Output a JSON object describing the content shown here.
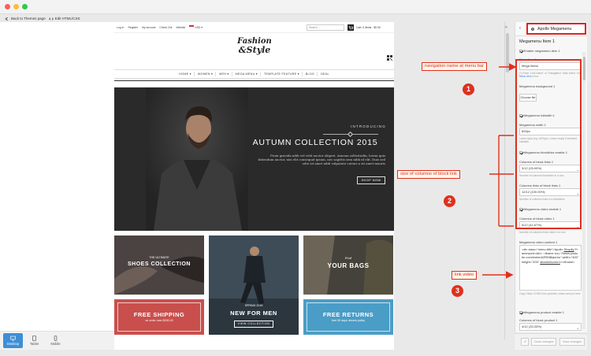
{
  "editor_toolbar": {
    "back_label": "Back to Themes page",
    "edit_label": "Edit HTML/CSS"
  },
  "devices": [
    {
      "label": "Desktop"
    },
    {
      "label": "Tablet"
    },
    {
      "label": "Mobile"
    }
  ],
  "site": {
    "topbar": {
      "links": [
        "Log In",
        "Register",
        "My account",
        "Check Out",
        "Wishlist"
      ],
      "currency": "USD",
      "search_placeholder": "Search ...",
      "cart_text": "Cart: 0 items - $0.00"
    },
    "logo": {
      "line1": "Fashion",
      "line2": "&Style"
    },
    "menu": [
      "HOME ▾",
      "WOMEN ▾",
      "MEN ▾",
      "MEGA MENU ▾",
      "TEMPLATE FEATURE ▾",
      "BLOG",
      "DEAL"
    ],
    "hero": {
      "intro": "INTRODUCING",
      "title": "AUTUMN COLLECTION 2015",
      "desc": "Proin gravida nibh vel velit auctor aliquet. Aenean sollicitudin, lorem quis bibendum auctor, nisi elit consequat ipsum, nec sagittis sem nibh id elit. Duis sed odio sit amet nibh vulputate cursus a sit amet mauris",
      "button": "SHOP NOW"
    },
    "tiles": {
      "shoes_small": "THE ULTIMATE",
      "shoes_big": "SHOES COLLECTION",
      "men_small": "SPRING 2015",
      "men_big": "NEW FOR MEN",
      "men_button": "VIEW COLLECTION",
      "bags_small": "Find",
      "bags_big": "YOUR BAGS",
      "shipping_big": "FREE SHIPPING",
      "shipping_small": "on order over $150.00",
      "returns_big": "FREE RETURNS",
      "returns_small": "free 90 days returns policy"
    }
  },
  "panel": {
    "title": "Apollo Megamenu",
    "section": "Megamenu Item 1",
    "enable_label": "Enable megamenu item 1",
    "menu_item_label": "Menu item 1",
    "menu_item_value": "Mega Menu",
    "menu_item_help_pre": "(*) Enter \"Link Name\" or \"Navigation\" Main Menu\" into",
    "menu_item_help_link": "Menu Item 1",
    "menu_item_help_post": "box",
    "background_label": "Megamenu background 1",
    "choose_file": "Choose file",
    "fullwidth_label": "Megamenu fullwidth 1",
    "width_label": "Megamenu width 1",
    "width_value": "600px",
    "width_help": "Leave input (eg: 1000px). Leave empty if selected fullwidth",
    "blocklinks_enable_label": "Megamenu blocklinks enable 1",
    "cols_links_label": "Columns of block links 1",
    "cols_links_value": "3/12 (25.00%)",
    "cols_links_help": "Number of columns blocklinks in a row",
    "cols_linklist_label": "Columns links of block links 1",
    "cols_linklist_value": "12/12 (100.00%)",
    "cols_linklist_help": "Number of columns links in a blocklinks",
    "video_enable_label": "Megamenu video enable 1",
    "cols_video_label": "Columns of block video 1",
    "cols_video_value": "5/12 (41.67%)",
    "cols_video_help": "Number of columns block video in a row",
    "video_content_label": "Megamenu video content 1",
    "video_content_value_a": "<div class=\"menu-title\">Apollo ",
    "video_content_value_link": "Shopify",
    "video_content_value_b": " Framework</div> <iframe src=\"//www.youtube.com/embed/ZRDiBqlw1w\" width=\"400\" height=\"200\" ",
    "video_content_value_u": "allowfullscreen",
    "video_content_value_c": "></iframe>",
    "video_help": "Copy Video CODE from youtube, vimeo and put here",
    "product_enable_label": "Megamenu product enable 1",
    "cols_product_label": "Columns of block product 1",
    "cols_product_value": "4/12 (33.33%)",
    "footer_buttons": [
      "Close changes",
      "Save changes"
    ]
  },
  "annotations": {
    "nav_callout": "navigation name at menu bar",
    "cols_callout": "size of columns of block link",
    "video_callout": "link video",
    "steps": [
      "1",
      "2",
      "3"
    ],
    "accent_color": "#e0301e"
  }
}
